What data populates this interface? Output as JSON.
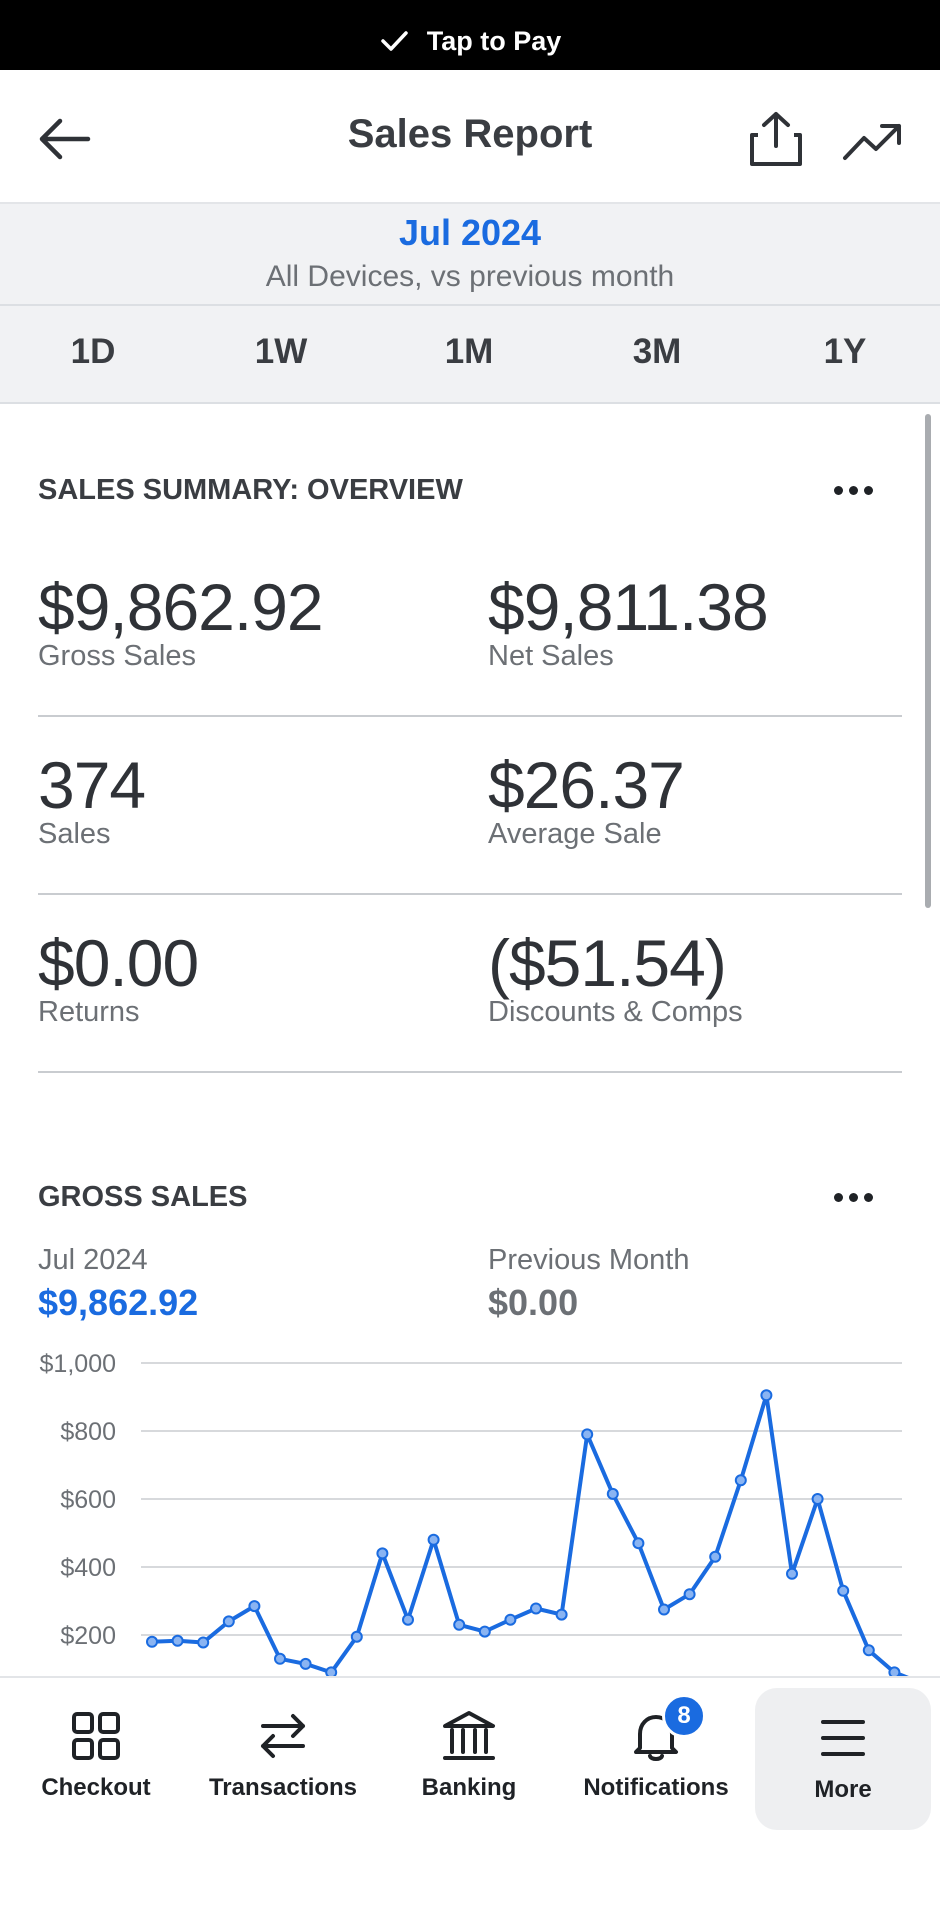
{
  "status_bar": {
    "label": "Tap to Pay"
  },
  "header": {
    "title": "Sales Report"
  },
  "period": {
    "month": "Jul 2024",
    "subtitle": "All Devices, vs previous month"
  },
  "ranges": [
    "1D",
    "1W",
    "1M",
    "3M",
    "1Y"
  ],
  "summary": {
    "title": "SALES SUMMARY: OVERVIEW",
    "metrics": [
      {
        "value": "$9,862.92",
        "label": "Gross Sales"
      },
      {
        "value": "$9,811.38",
        "label": "Net Sales"
      },
      {
        "value": "374",
        "label": "Sales"
      },
      {
        "value": "$26.37",
        "label": "Average Sale"
      },
      {
        "value": "$0.00",
        "label": "Returns"
      },
      {
        "value": "($51.54)",
        "label": "Discounts & Comps"
      }
    ]
  },
  "gross_sales": {
    "title": "GROSS SALES",
    "current_label": "Jul 2024",
    "current_value": "$9,862.92",
    "previous_label": "Previous Month",
    "previous_value": "$0.00"
  },
  "chart_data": {
    "type": "line",
    "ylim": [
      0,
      1000
    ],
    "y_ticks": [
      "$200",
      "$400",
      "$600",
      "$800",
      "$1,000"
    ],
    "y_tick_values": [
      200,
      400,
      600,
      800,
      1000
    ],
    "x": [
      1,
      2,
      3,
      4,
      5,
      6,
      7,
      8,
      9,
      10,
      11,
      12,
      13,
      14,
      15,
      16,
      17,
      18,
      19,
      20,
      21,
      22,
      23,
      24,
      25,
      26,
      27,
      28,
      29,
      30,
      31
    ],
    "series": [
      {
        "color": "#1a6be0",
        "values": [
          180,
          183,
          178,
          240,
          285,
          130,
          115,
          90,
          195,
          440,
          245,
          480,
          230,
          210,
          245,
          278,
          260,
          790,
          615,
          470,
          275,
          320,
          430,
          655,
          905,
          380,
          600,
          330,
          155,
          90,
          60
        ]
      }
    ]
  },
  "tabbar": {
    "items": [
      {
        "label": "Checkout",
        "icon": "grid-icon"
      },
      {
        "label": "Transactions",
        "icon": "swap-arrows-icon"
      },
      {
        "label": "Banking",
        "icon": "bank-icon"
      },
      {
        "label": "Notifications",
        "icon": "bell-icon"
      },
      {
        "label": "More",
        "icon": "menu-icon"
      }
    ],
    "notification_count": "8"
  }
}
